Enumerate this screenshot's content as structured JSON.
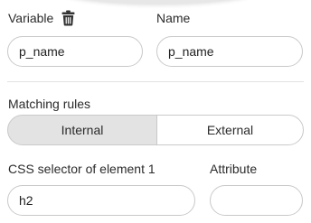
{
  "variable": {
    "label": "Variable",
    "value": "p_name",
    "delete_icon": "trash-icon"
  },
  "name": {
    "label": "Name",
    "value": "p_name"
  },
  "matching_rules": {
    "label": "Matching rules",
    "options": [
      "Internal",
      "External"
    ],
    "selected": "Internal"
  },
  "css_selector": {
    "label": "CSS selector of element 1",
    "value": "h2"
  },
  "attribute": {
    "label": "Attribute",
    "value": ""
  }
}
